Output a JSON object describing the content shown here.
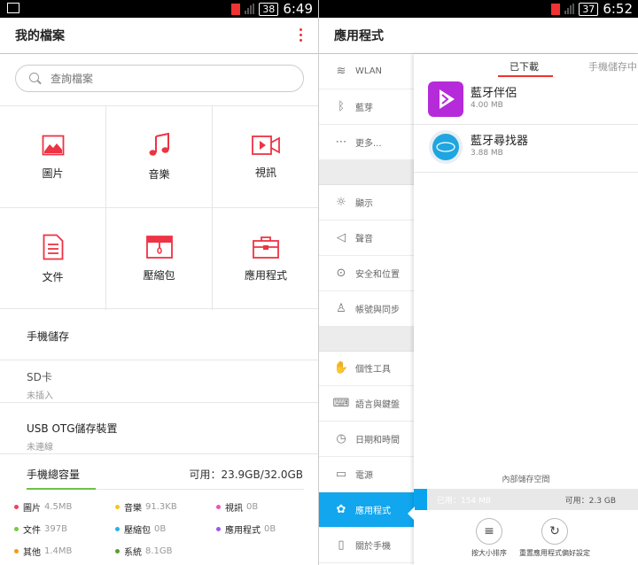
{
  "left": {
    "status": {
      "battery": "38",
      "time": "6:49"
    },
    "title": "我的檔案",
    "search_placeholder": "查詢檔案",
    "categories": [
      {
        "label": "圖片",
        "icon": "image-icon"
      },
      {
        "label": "音樂",
        "icon": "music-note-icon"
      },
      {
        "label": "視訊",
        "icon": "video-camera-icon"
      },
      {
        "label": "文件",
        "icon": "document-icon"
      },
      {
        "label": "壓縮包",
        "icon": "archive-icon"
      },
      {
        "label": "應用程式",
        "icon": "briefcase-icon"
      }
    ],
    "storage_rows": [
      {
        "title": "手機儲存",
        "sub": ""
      },
      {
        "title": "SD卡",
        "sub": "未插入"
      },
      {
        "title": "USB OTG儲存裝置",
        "sub": "未連線"
      }
    ],
    "capacity": {
      "heading": "手機總容量",
      "available": "可用：23.9GB/32.0GB",
      "items": [
        {
          "label": "圖片",
          "value": "4.5MB",
          "color": "#ee4455"
        },
        {
          "label": "音樂",
          "value": "91.3KB",
          "color": "#f5c518"
        },
        {
          "label": "視訊",
          "value": "0B",
          "color": "#ee55aa"
        },
        {
          "label": "文件",
          "value": "397B",
          "color": "#7ac943"
        },
        {
          "label": "壓縮包",
          "value": "0B",
          "color": "#2ab0e8"
        },
        {
          "label": "應用程式",
          "value": "0B",
          "color": "#9b59e8"
        },
        {
          "label": "其他",
          "value": "1.4MB",
          "color": "#f39c12"
        },
        {
          "label": "系統",
          "value": "8.1GB",
          "color": "#5a9e2f"
        }
      ]
    }
  },
  "right": {
    "status": {
      "battery": "37",
      "time": "6:52"
    },
    "title": "應用程式",
    "sidebar": [
      {
        "label": "WLAN",
        "icon": "wifi-icon"
      },
      {
        "label": "藍芽",
        "icon": "bluetooth-icon"
      },
      {
        "label": "更多...",
        "icon": "more-dots-icon"
      },
      {
        "label": "顯示",
        "icon": "brightness-icon"
      },
      {
        "label": "聲音",
        "icon": "speaker-icon"
      },
      {
        "label": "安全和位置",
        "icon": "location-pin-icon"
      },
      {
        "label": "帳號與同步",
        "icon": "person-icon"
      },
      {
        "label": "個性工具",
        "icon": "hand-icon"
      },
      {
        "label": "語言與鍵盤",
        "icon": "keyboard-icon"
      },
      {
        "label": "日期和時間",
        "icon": "clock-icon"
      },
      {
        "label": "電源",
        "icon": "battery-icon"
      },
      {
        "label": "應用程式",
        "icon": "apps-grid-icon"
      },
      {
        "label": "關於手機",
        "icon": "phone-icon"
      }
    ],
    "tabs": [
      "已下載",
      "手機儲存中"
    ],
    "apps": [
      {
        "name": "藍牙伴侶",
        "size": "4.00 MB",
        "icon": "bluetooth-companion-app-icon"
      },
      {
        "name": "藍牙尋找器",
        "size": "3.88 MB",
        "icon": "bluetooth-finder-app-icon"
      }
    ],
    "storage": {
      "label": "內部儲存空間",
      "used": "已用：154 MB",
      "available": "可用：2.3 GB",
      "used_fraction": 0.06
    },
    "actions": [
      {
        "label": "按大小排序",
        "icon": "sort-lines-icon"
      },
      {
        "label": "重置應用程式偏好設定",
        "icon": "reset-icon"
      }
    ]
  }
}
